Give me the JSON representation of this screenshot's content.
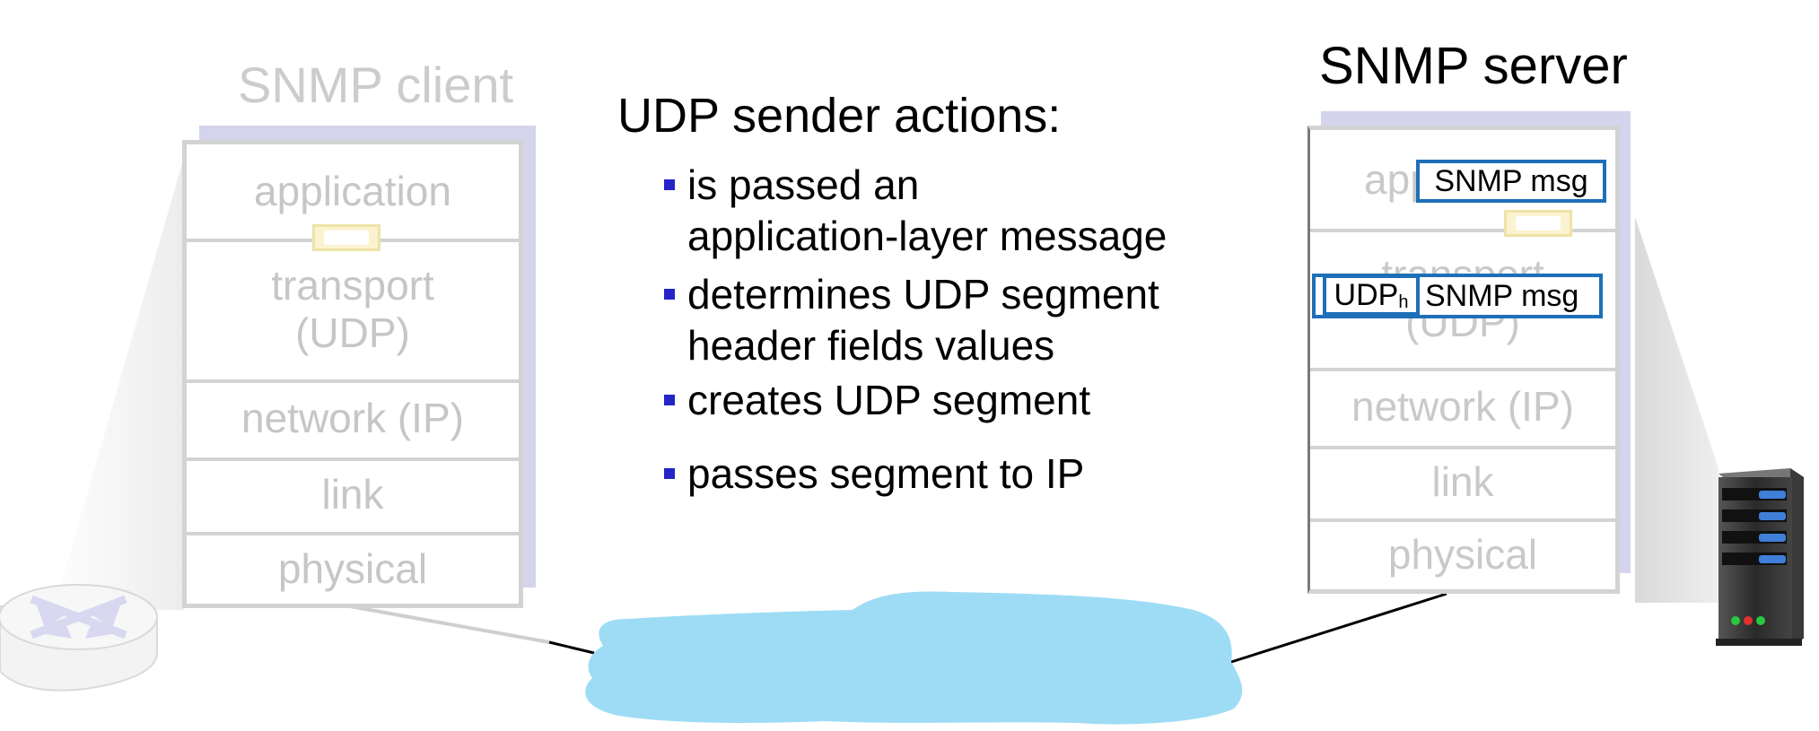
{
  "client": {
    "title": "SNMP client",
    "layers": [
      "application",
      "transport\n(UDP)",
      "network (IP)",
      "link",
      "physical"
    ]
  },
  "server": {
    "title": "SNMP server",
    "layers": [
      "application",
      "transport\n(UDP)",
      "network (IP)",
      "link",
      "physical"
    ],
    "app_msg": "SNMP msg",
    "udp_header": "UDP",
    "udp_header_sub": "h",
    "transport_msg": "SNMP msg"
  },
  "text": {
    "heading": "UDP sender actions:",
    "bullets": [
      "is passed an\napplication-layer message",
      "determines UDP segment\nheader fields values",
      "creates UDP segment",
      "passes segment to IP"
    ]
  },
  "colors": {
    "cloud": "#9edcf5",
    "stack_shadow": "#d4d4ec",
    "message_border": "#1f6fb8",
    "bullet": "#2424c8"
  },
  "icons": [
    "router-icon",
    "server-icon",
    "network-cloud",
    "envelope-icon"
  ]
}
